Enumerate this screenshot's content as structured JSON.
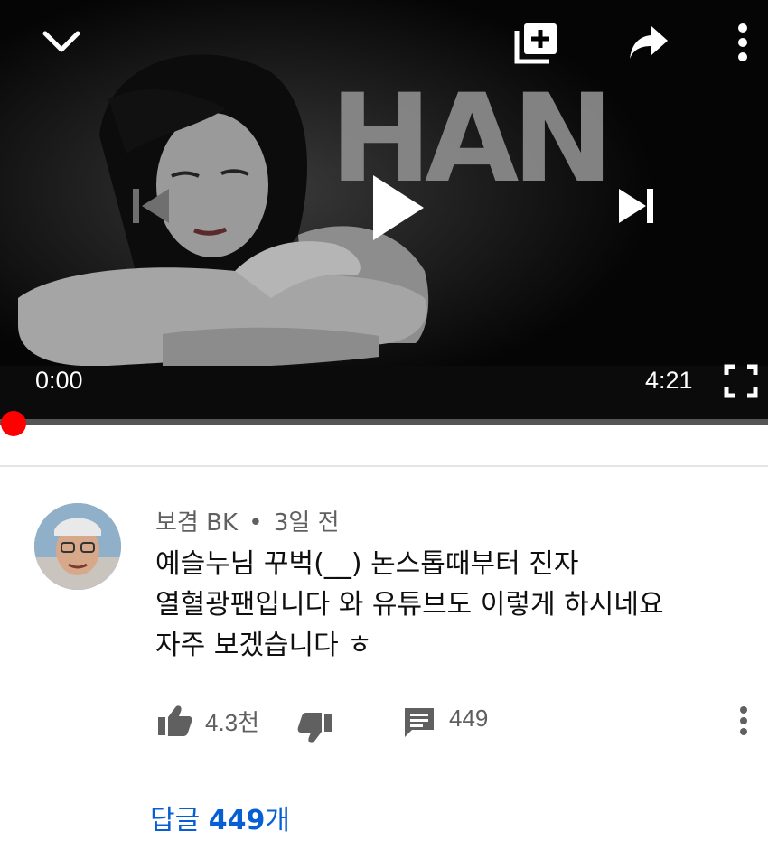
{
  "player": {
    "title_art": "HAN",
    "current_time": "0:00",
    "duration": "4:21",
    "progress": 0,
    "icons": {
      "collapse": "chevron-down-icon",
      "add_to_playlist": "playlist-add-icon",
      "share": "share-icon",
      "more": "more-vert-icon",
      "previous": "skip-previous-icon",
      "play": "play-icon",
      "next": "skip-next-icon",
      "fullscreen": "fullscreen-icon"
    },
    "colors": {
      "progress": "#ff0000",
      "track": "#555555"
    }
  },
  "comment": {
    "author": "보겸 BK",
    "separator": "•",
    "age": "3일 전",
    "text_lines": [
      "예슬누님 꾸벅(__) 논스톱때부터 진자",
      "열혈광팬입니다 와 유튜브도 이렇게 하시네요",
      "자주 보겠습니다 ㅎ"
    ],
    "likes": "4.3천",
    "reply_count": "449",
    "replies_prefix": "답글 ",
    "replies_count_bold": "449",
    "replies_suffix": "개",
    "accent_color": "#065fd4"
  }
}
